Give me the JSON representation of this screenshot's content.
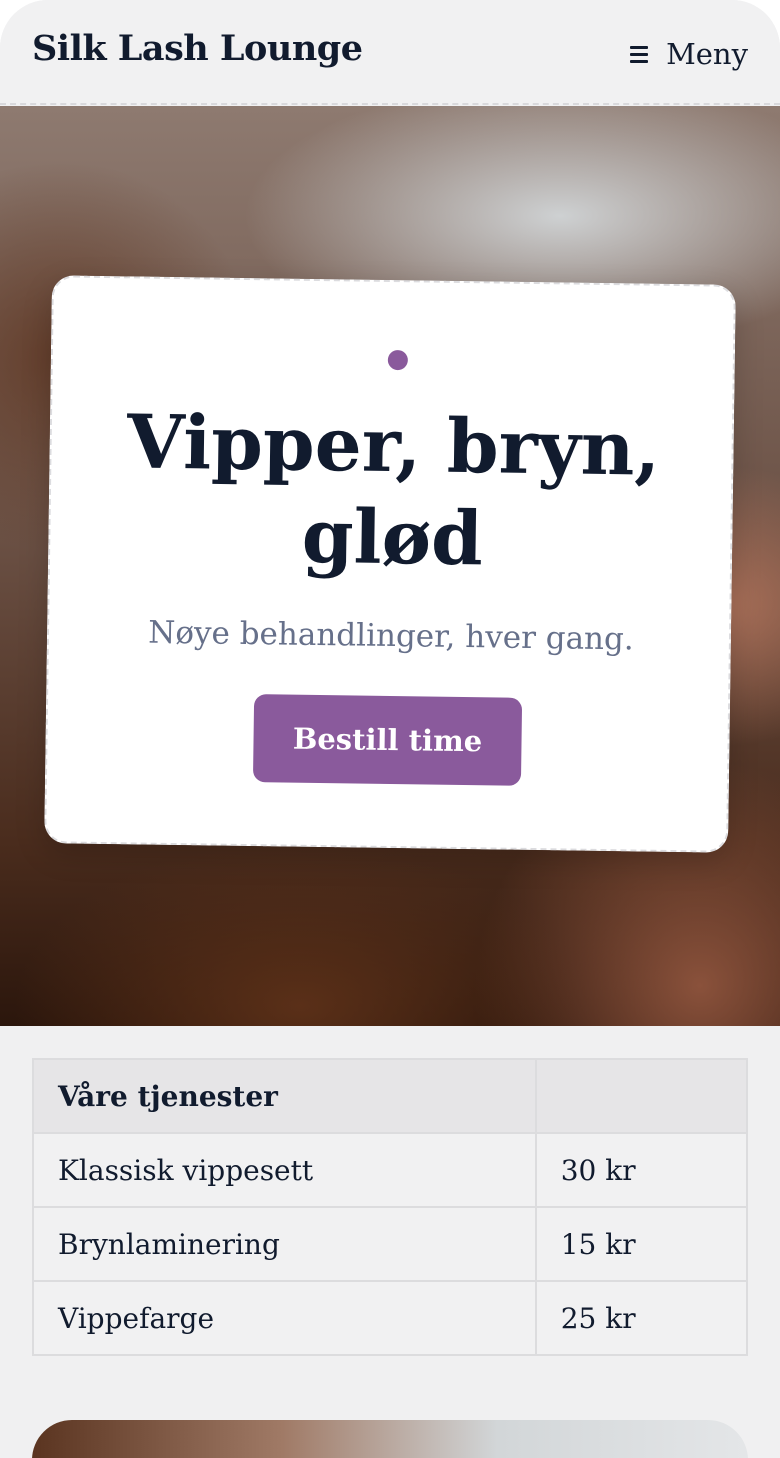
{
  "header": {
    "brand": "Silk Lash Lounge",
    "menu_label": "Meny",
    "menu_icon": "hamburger-icon"
  },
  "hero": {
    "title": "Vipper, bryn, glød",
    "subtitle": "Nøye behandlinger, hver gang.",
    "cta_label": "Bestill time",
    "accent_color": "#8a5a9c",
    "text_color": "#111b2e",
    "subtitle_color": "#66708a"
  },
  "services": {
    "header": [
      "Våre tjenester",
      ""
    ],
    "rows": [
      {
        "name": "Klassisk vippesett",
        "price": "30 kr"
      },
      {
        "name": "Brynlaminering",
        "price": "15 kr"
      },
      {
        "name": "Vippefarge",
        "price": "25 kr"
      }
    ]
  }
}
